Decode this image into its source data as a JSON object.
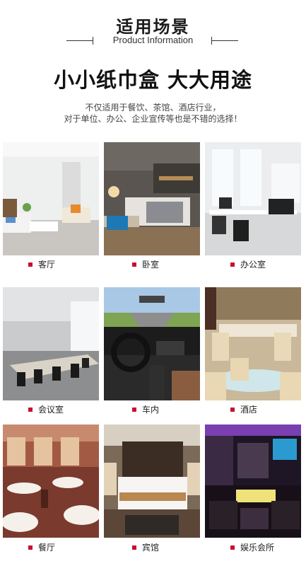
{
  "header": {
    "title": "适用场景",
    "subtitle": "Product Information"
  },
  "headline": "小小纸巾盒 大大用途",
  "description": {
    "line1": "不仅适用于餐饮、茶馆、酒店行业，",
    "line2": "对于单位、办公、企业宣传等也是不错的选择！"
  },
  "accent_color": "#c8102e",
  "scenes": [
    {
      "label": "客厅",
      "image": "living-room-photo"
    },
    {
      "label": "卧室",
      "image": "bedroom-photo"
    },
    {
      "label": "办公室",
      "image": "office-photo"
    },
    {
      "label": "会议室",
      "image": "meeting-room-photo"
    },
    {
      "label": "车内",
      "image": "car-interior-photo"
    },
    {
      "label": "酒店",
      "image": "hotel-dining-photo"
    },
    {
      "label": "餐厅",
      "image": "restaurant-photo"
    },
    {
      "label": "宾馆",
      "image": "guest-room-photo"
    },
    {
      "label": "娱乐会所",
      "image": "entertainment-club-photo"
    }
  ]
}
